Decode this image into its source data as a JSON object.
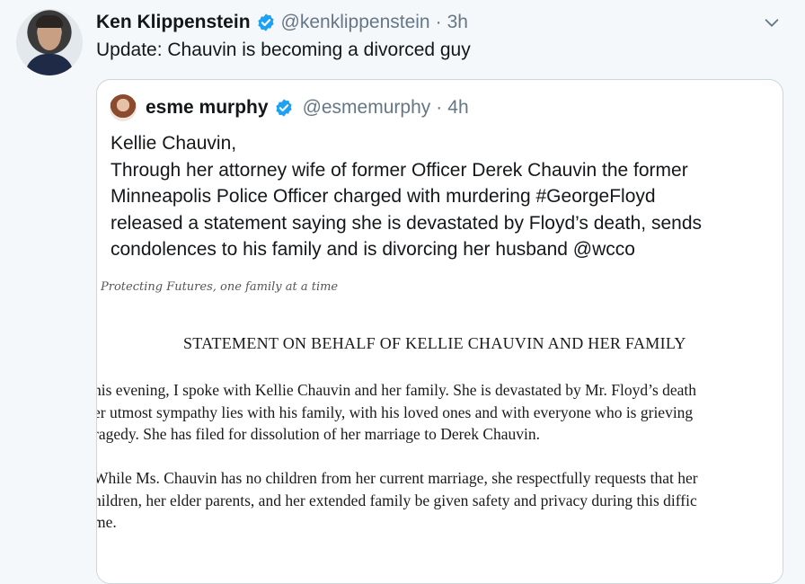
{
  "tweet": {
    "author_name": "Ken Klippenstein",
    "author_handle": "@kenklippenstein",
    "separator": "·",
    "time": "3h",
    "text": "Update: Chauvin is becoming a divorced guy"
  },
  "quote": {
    "author_name": "esme murphy",
    "author_handle": "@esmemurphy",
    "separator": "·",
    "time": "4h",
    "lines": [
      "Kellie Chauvin,",
      "Through her attorney wife of former Officer Derek Chauvin the former",
      "Minneapolis Police Officer charged with murdering #GeorgeFloyd",
      "released a statement saying she is devastated by Floyd’s death, sends",
      "condolences to his family and is divorcing her husband @wcco"
    ]
  },
  "document": {
    "letterhead": "Protecting Futures, one family at a time",
    "title": "STATEMENT ON BEHALF OF KELLIE CHAUVIN AND HER FAMILY",
    "paragraph1": [
      "his evening, I spoke with Kellie Chauvin and her family. She is devastated by Mr. Floyd’s death",
      "er utmost sympathy lies with his family, with his loved ones and with everyone who is grieving",
      "ragedy. She has filed for dissolution of her marriage to Derek Chauvin."
    ],
    "paragraph2": [
      "While Ms. Chauvin has no children from her current marriage, she respectfully requests that her",
      "hildren, her elder parents, and her extended family be given safety and privacy during this diffic",
      "me."
    ]
  },
  "colors": {
    "verified_blue": "#1da1f2",
    "secondary_text": "#657786",
    "border": "#ccd6dd",
    "background": "#f5f8fa"
  },
  "icons": {
    "verified": "verified-badge-icon",
    "more": "chevron-down-icon"
  }
}
